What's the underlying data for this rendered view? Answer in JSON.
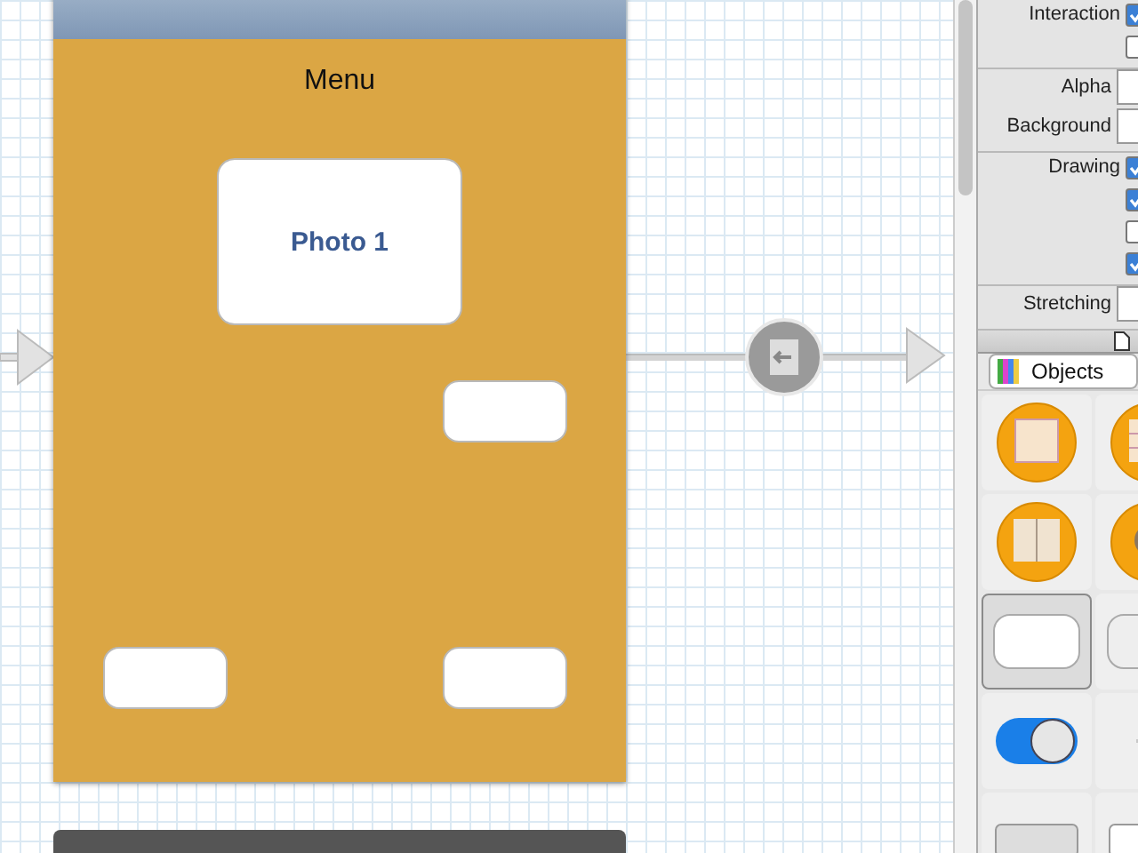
{
  "scene": {
    "title": "Menu",
    "buttons": [
      {
        "kind": "large",
        "label": "Photo 1"
      },
      {
        "kind": "small"
      },
      {
        "kind": "small"
      },
      {
        "kind": "small"
      }
    ]
  },
  "inspector": {
    "sections": [
      {
        "rows": [
          {
            "kind": "checkbox",
            "label": "Interaction",
            "checked": true
          },
          {
            "kind": "checkbox",
            "checked": false
          }
        ]
      },
      {
        "rows": [
          {
            "kind": "field",
            "label": "Alpha"
          },
          {
            "kind": "field",
            "label": "Background"
          }
        ]
      },
      {
        "rows": [
          {
            "kind": "checkbox",
            "label": "Drawing",
            "checked": true
          },
          {
            "kind": "checkbox",
            "checked": true
          },
          {
            "kind": "checkbox",
            "checked": false
          },
          {
            "kind": "checkbox",
            "checked": true
          }
        ]
      },
      {
        "rows": [
          {
            "kind": "field",
            "label": "Stretching"
          }
        ]
      }
    ]
  },
  "library": {
    "selector": "Objects",
    "items": [
      {
        "kind": "controller",
        "selected": false
      },
      {
        "kind": "table-controller",
        "selected": false
      },
      {
        "kind": "split-controller",
        "selected": false
      },
      {
        "kind": "media-controller",
        "selected": false
      },
      {
        "kind": "rounded-button",
        "selected": true
      },
      {
        "kind": "segmented",
        "selected": false
      },
      {
        "kind": "switch",
        "selected": false
      },
      {
        "kind": "gesture",
        "selected": false
      },
      {
        "kind": "stepper",
        "selected": false
      },
      {
        "kind": "text-field",
        "selected": false
      }
    ]
  }
}
